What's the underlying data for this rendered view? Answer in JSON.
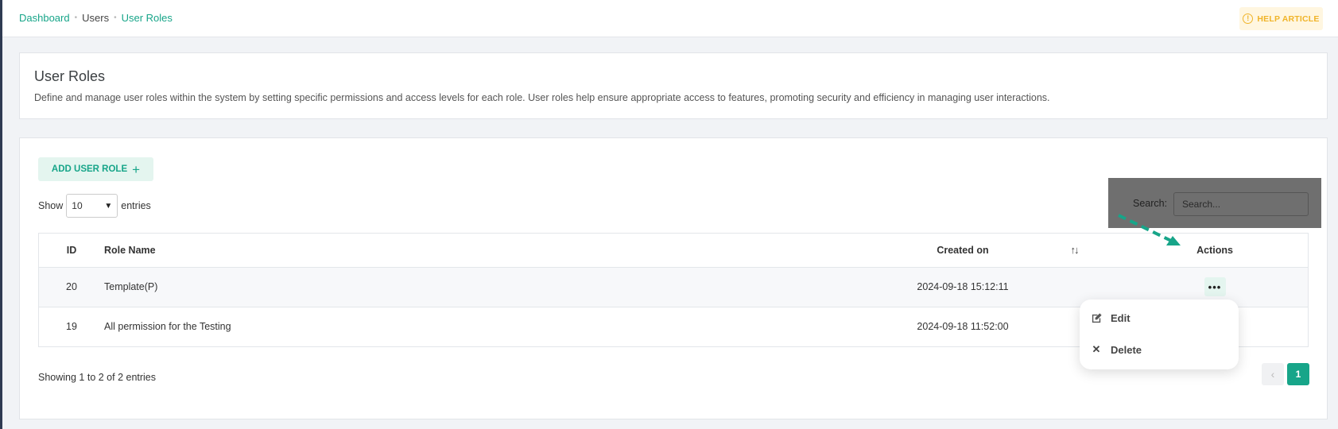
{
  "breadcrumb": {
    "items": [
      "Dashboard",
      "Users",
      "User Roles"
    ],
    "separator": "•"
  },
  "help_button": {
    "label": "HELP ARTICLE",
    "icon": "info-icon"
  },
  "intro": {
    "title": "User Roles",
    "description": "Define and manage user roles within the system by setting specific permissions and access levels for each role. User roles help ensure appropriate access to features, promoting security and efficiency in managing user interactions."
  },
  "toolbar": {
    "add_label": "ADD USER ROLE",
    "add_icon": "plus-icon",
    "show_label": "Show",
    "entries_value": "10",
    "entries_label": "entries",
    "search_label": "Search:",
    "search_placeholder": "Search..."
  },
  "table": {
    "headers": {
      "id": "ID",
      "name": "Role Name",
      "created": "Created on",
      "actions": "Actions"
    },
    "sort_icon": "↑↓",
    "rows": [
      {
        "id": "20",
        "name": "Template(P)",
        "created": "2024-09-18 15:12:11"
      },
      {
        "id": "19",
        "name": "All permission for the Testing",
        "created": "2024-09-18 11:52:00"
      }
    ],
    "actions_icon": "•••"
  },
  "footer": {
    "showing": "Showing 1 to 2 of 2 entries",
    "prev": "‹",
    "page": "1"
  },
  "action_menu": {
    "edit_label": "Edit",
    "delete_label": "Delete"
  },
  "colors": {
    "accent": "#17a589",
    "help": "#f0b429",
    "overlay": "#6f6f6f"
  }
}
